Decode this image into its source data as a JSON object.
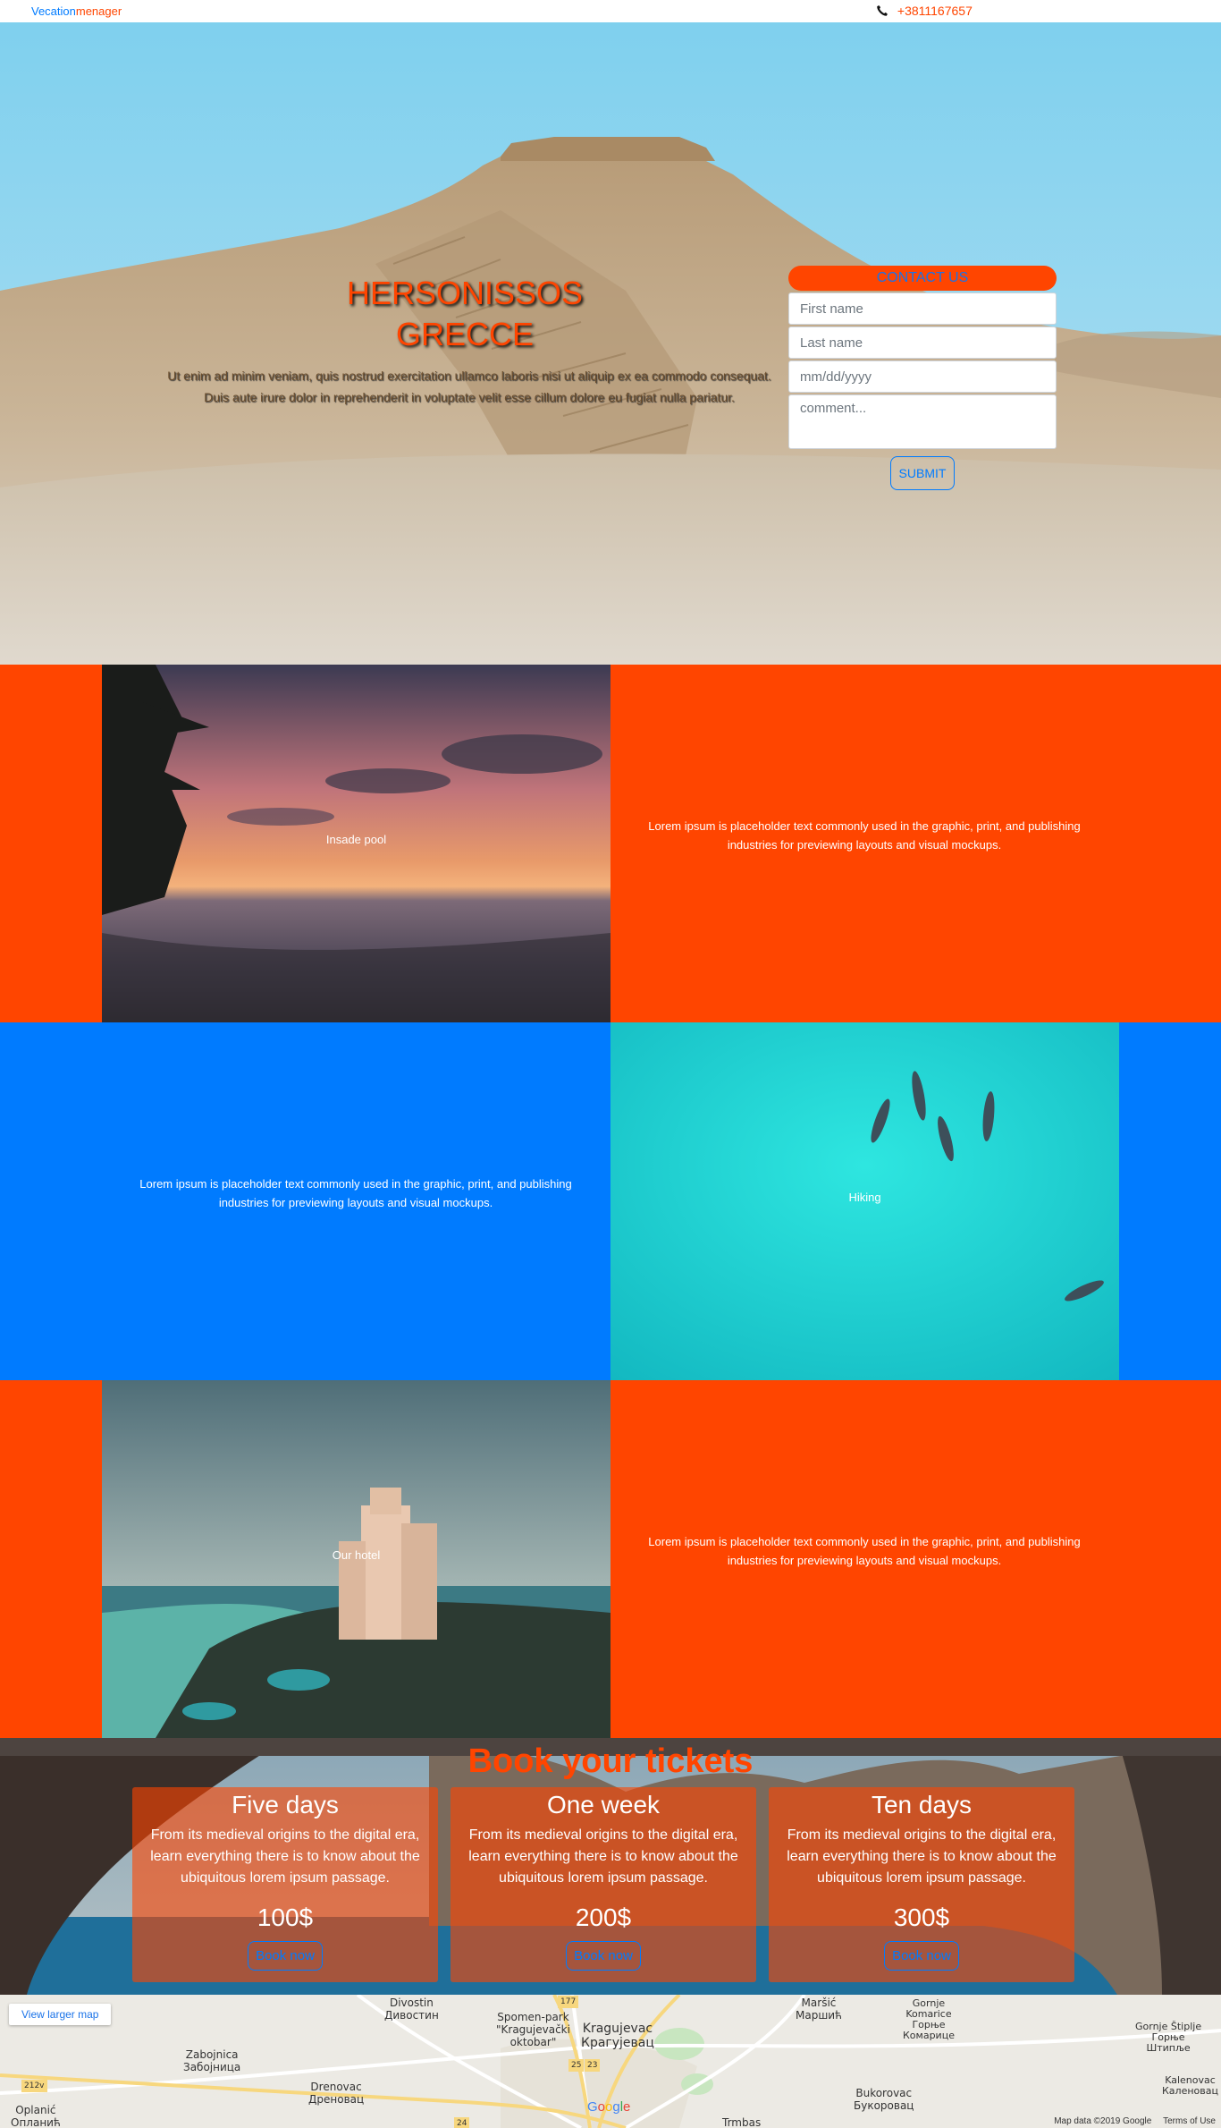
{
  "nav": {
    "brand_part1": "Vecation",
    "brand_part2": "menager",
    "phone": "+3811167657",
    "phone_icon": "phone-icon"
  },
  "hero": {
    "title_line1": "HERSONISSOS",
    "title_line2": "GRECCE",
    "text": "Ut enim ad minim veniam, quis nostrud exercitation ullamco laboris nisi ut aliquip ex ea commodo consequat. Duis aute irure dolor in reprehenderit in voluptate velit esse cillum dolore eu fugiat nulla pariatur."
  },
  "contact": {
    "heading": "CONTACT US",
    "first_name_placeholder": "First name",
    "last_name_placeholder": "Last name",
    "date_placeholder": "mm/dd/yyyy",
    "comment_placeholder": "comment...",
    "submit_label": "SUBMIT"
  },
  "features": [
    {
      "caption": "Insade pool",
      "text": "Lorem ipsum is placeholder text commonly used in the graphic, print, and publishing industries for previewing layouts and visual mockups."
    },
    {
      "caption": "Hiking",
      "text": "Lorem ipsum is placeholder text commonly used in the graphic, print, and publishing industries for previewing layouts and visual mockups."
    },
    {
      "caption": "Our hotel",
      "text": "Lorem ipsum is placeholder text commonly used in the graphic, print, and publishing industries for previewing layouts and visual mockups."
    }
  ],
  "tickets": {
    "title": "Book your tickets",
    "cards": [
      {
        "title": "Five days",
        "desc": "From its medieval origins to the digital era, learn everything there is to know about the ubiquitous lorem ipsum passage.",
        "price": "100$",
        "button": "Book now"
      },
      {
        "title": "One week",
        "desc": "From its medieval origins to the digital era, learn everything there is to know about the ubiquitous lorem ipsum passage.",
        "price": "200$",
        "button": "Book now"
      },
      {
        "title": "Ten days",
        "desc": "From its medieval origins to the digital era, learn everything there is to know about the ubiquitous lorem ipsum passage.",
        "price": "300$",
        "button": "Book now"
      }
    ]
  },
  "map": {
    "view_larger": "View larger map",
    "labels": {
      "divostin": "Divostin\nДивостин",
      "spomen": "Spomen-park\n\"Kragujevački\noktobar\"",
      "kragujevac": "Kragujevac\nКрагујевац",
      "marsic": "Maršić\nМаршић",
      "komarice": "Gornje\nKomarice\nГорње\nКомарице",
      "stiplje": "Gornje Štiplje\nГорње\nШтипље",
      "zabojnica": "Zabojnica\nЗабојница",
      "drenovac": "Drenovac\nДреновац",
      "bukorovac": "Bukorovac\nБукоровац",
      "kalenovac": "Kalenovac\nКаленовац",
      "oplanic": "Oplanić\nОпланић",
      "trmbas": "Trmbas",
      "road_177": "177",
      "road_212v": "212v",
      "road_25": "25",
      "road_23": "23",
      "road_24": "24"
    },
    "attribution": "Map data ©2019 Google",
    "terms": "Terms of Use",
    "google": "Google"
  }
}
